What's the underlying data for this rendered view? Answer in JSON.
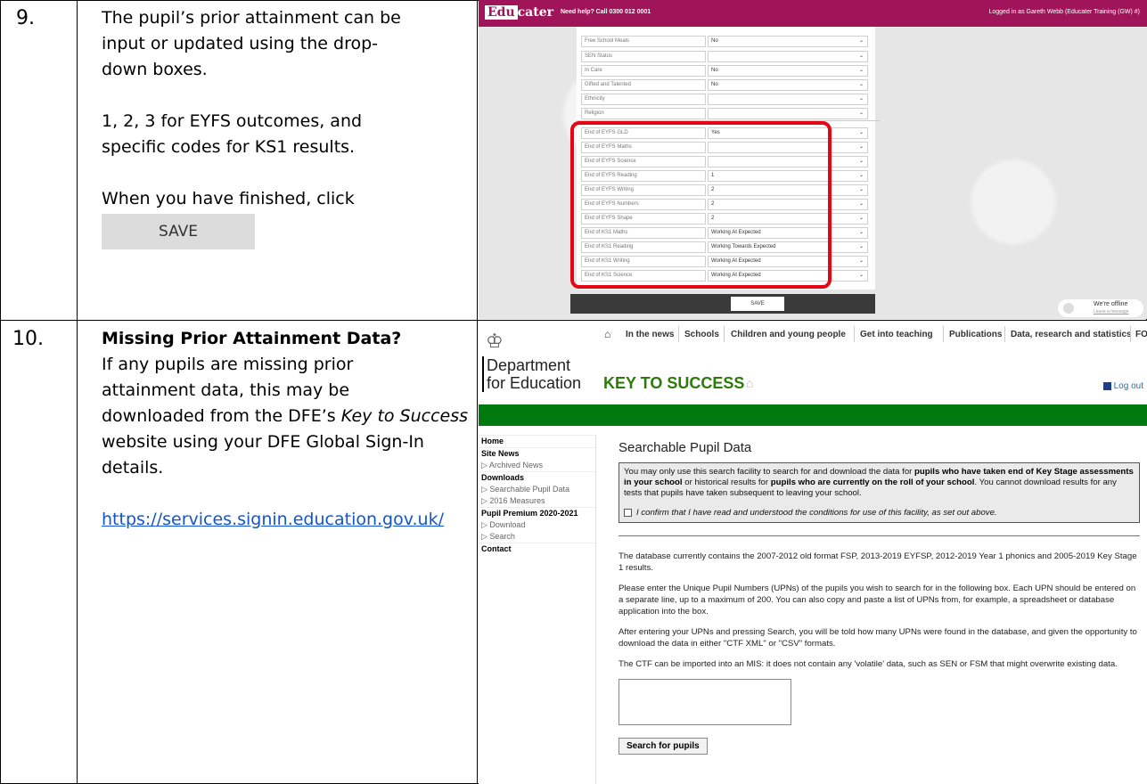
{
  "step9": {
    "number": "9.",
    "lines": [
      "The pupil’s prior attainment can be",
      "input or updated using the drop-",
      "down boxes."
    ],
    "outcomes_lines": [
      "1, 2, 3 for EYFS outcomes, and",
      "specific codes for KS1 results."
    ],
    "finish_text": "When you have finished, click",
    "save_button": "SAVE"
  },
  "step10": {
    "number": "10.",
    "heading": "Missing Prior Attainment Data?",
    "body_parts": [
      "If any pupils are missing prior",
      "attainment data, this may be",
      "downloaded from the DFE’s "
    ],
    "italic": "Key to Success",
    "body_rest": " website using your DFE Global Sign-In details.",
    "link": "https://services.signin.education.gov.uk/"
  },
  "educater": {
    "logo_box": "Edu",
    "logo_rest": "cater",
    "help": "Need help? Call 0300 012 0001",
    "logged_in": "Logged in as Gareth Webb (Educater Training (GW) #)",
    "rows": [
      {
        "label": "Free School Meals",
        "value": "No"
      },
      {
        "label": "SEN Status",
        "value": ""
      },
      {
        "label": "In Care",
        "value": "No"
      },
      {
        "label": "Gifted and Talented",
        "value": "No"
      },
      {
        "label": "Ethnicity",
        "value": ""
      },
      {
        "label": "Religion",
        "value": ""
      },
      {
        "label": "End of EYFS GLD",
        "value": "Yes"
      },
      {
        "label": "End of EYFS Maths",
        "value": ""
      },
      {
        "label": "End of EYFS Science",
        "value": ""
      },
      {
        "label": "End of EYFS Reading",
        "value": "1"
      },
      {
        "label": "End of EYFS Writing",
        "value": "2"
      },
      {
        "label": "End of EYFS Numbers",
        "value": "2"
      },
      {
        "label": "End of EYFS Shape",
        "value": "2"
      },
      {
        "label": "End of KS1 Maths",
        "value": "Working At Expected"
      },
      {
        "label": "End of KS1 Reading",
        "value": "Working Towards Expected"
      },
      {
        "label": "End of KS1 Writing",
        "value": "Working At Expected"
      },
      {
        "label": "End of KS1 Science",
        "value": "Working At Expected"
      }
    ],
    "save": "SAVE",
    "offline": "We're offline",
    "offline_sub": "Leave a message"
  },
  "dfe": {
    "nav": [
      "In the news",
      "Schools",
      "Children and young people",
      "Get into teaching",
      "Publications",
      "Data, research and statistics",
      "FOI"
    ],
    "dept_line1": "Department",
    "dept_line2": "for Education",
    "site": "KEY TO SUCCESS",
    "logout": "Log out",
    "sidebar": [
      {
        "text": "Home",
        "kind": "b"
      },
      {
        "text": "Site News",
        "kind": "b"
      },
      {
        "text": "▷ Archived News",
        "kind": "s"
      },
      {
        "text": "Downloads",
        "kind": "b"
      },
      {
        "text": "▷ Searchable Pupil Data",
        "kind": "s"
      },
      {
        "text": "▷ 2016 Measures",
        "kind": "s"
      },
      {
        "text": "Pupil Premium 2020-2021",
        "kind": "b"
      },
      {
        "text": "▷ Download",
        "kind": "s"
      },
      {
        "text": "▷ Search",
        "kind": "s"
      },
      {
        "text": "Contact",
        "kind": "b"
      }
    ],
    "title": "Searchable Pupil Data",
    "warn_a": "You may only use this search facility to search for and download the data for ",
    "warn_b": "pupils who have taken end of Key Stage assessments in your school",
    "warn_c": " or historical results for ",
    "warn_d": "pupils who are currently on the roll of your school",
    "warn_e": ". You cannot download results for any tests that pupils have taken subsequent to leaving your school.",
    "confirm": "I confirm that I have read and understood the conditions for use of this facility, as set out above.",
    "p1": "The database currently contains the 2007-2012 old format FSP, 2013-2019 EYFSP, 2012-2019 Year 1 phonics and 2005-2019 Key Stage 1 results.",
    "p2": "Please enter the Unique Pupil Numbers (UPNs) of the pupils you wish to search for in the following box. Each UPN should be entered on a separate line, up to a maximum of 200. You can also copy and paste a list of UPNs from, for example, a spreadsheet or database application into the box.",
    "p3": "After entering your UPNs and pressing Search, you will be told how many UPNs were found in the database, and given the opportunity to download the data in either \"CTF XML\" or \"CSV\" formats.",
    "p4": "The CTF can be imported into an MIS: it does not contain any 'volatile' data, such as SEN or FSM that might overwrite existing data.",
    "button": "Search for pupils"
  }
}
